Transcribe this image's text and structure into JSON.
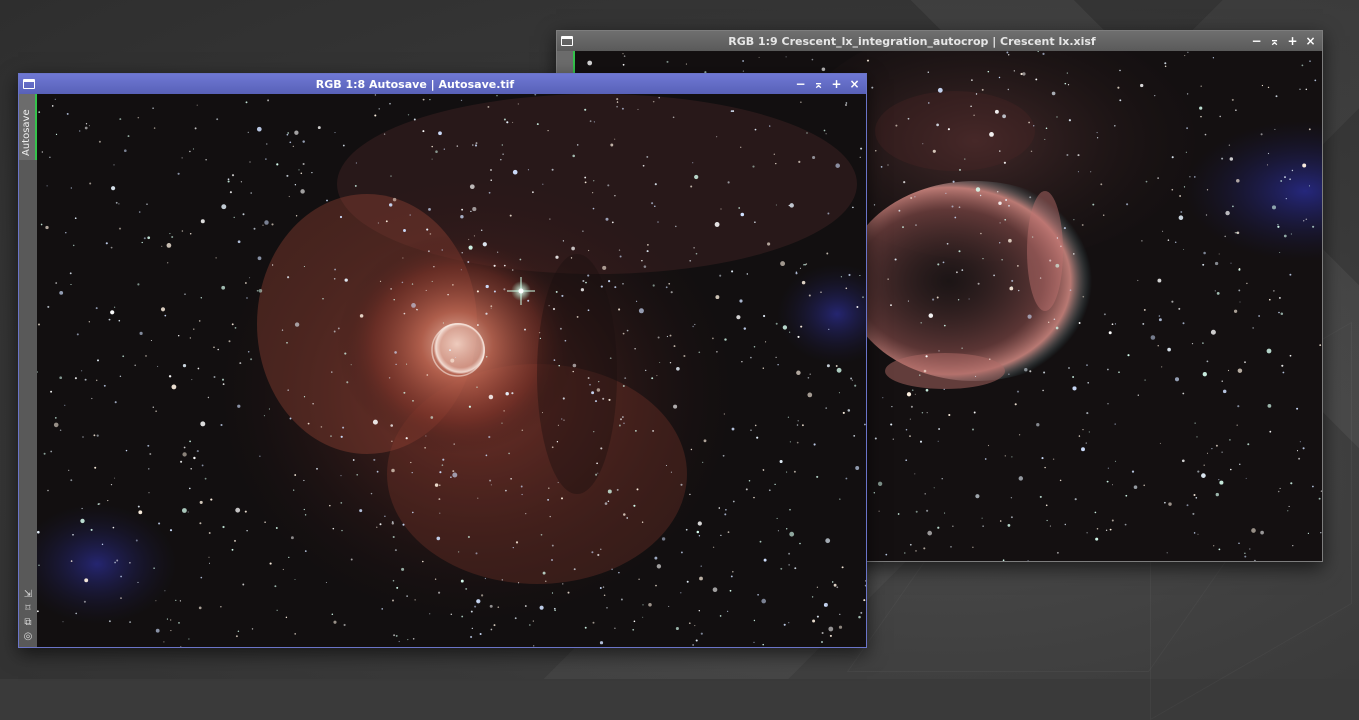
{
  "windows": [
    {
      "id": "crescent",
      "title": "RGB 1:9 Crescent_lx_integration_autocrop | Crescent lx.xisf",
      "side_tab": "0",
      "icons": [
        "minimize-icon",
        "shade-icon",
        "maximize-icon",
        "close-icon"
      ]
    },
    {
      "id": "autosave",
      "title": "RGB 1:8 Autosave | Autosave.tif",
      "side_tab": "Autosave",
      "icons": [
        "minimize-icon",
        "shade-icon",
        "maximize-icon",
        "close-icon"
      ],
      "rail_tools": [
        "fit-view-icon",
        "zoom-frame-icon",
        "clone-view-icon",
        "target-icon"
      ]
    }
  ],
  "controls": {
    "minimize": "−",
    "shade": "⌅",
    "maximize": "+",
    "close": "×"
  },
  "colors": {
    "active_title": "#5f68c0",
    "inactive_title": "#636363",
    "active_tab_indicator": "#34c34c",
    "nebula_red": "#b5473a",
    "background": "#3a3a3a"
  }
}
